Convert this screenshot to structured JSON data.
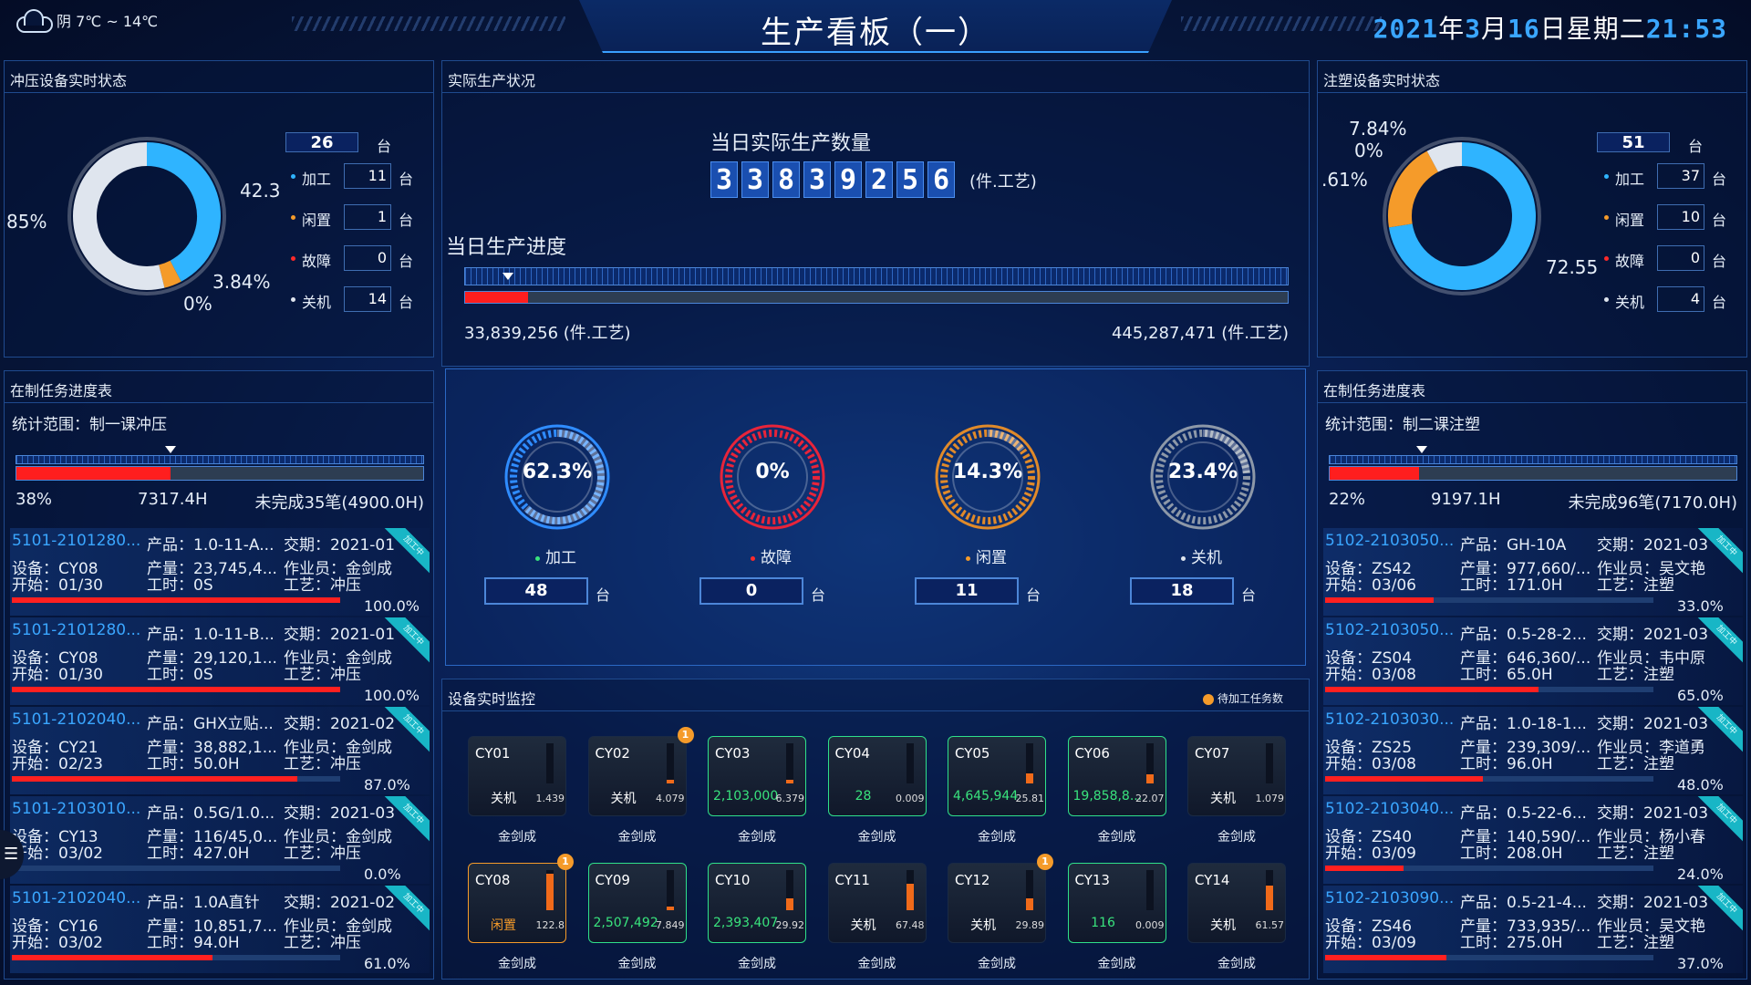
{
  "header": {
    "title": "生产看板（一）",
    "weather": "阴 7℃ ~ 14℃",
    "date_year": "2021",
    "date_month": "3",
    "date_day": "16",
    "weekday": "日星期二",
    "time": "21:53"
  },
  "left_top": {
    "title": "冲压设备实时状态",
    "total": "26",
    "unit": "台",
    "legend": [
      {
        "label": "加工",
        "value": "11",
        "color": "#2fb4ff"
      },
      {
        "label": "闲置",
        "value": "1",
        "color": "#f59b2a"
      },
      {
        "label": "故障",
        "value": "0",
        "color": "#ff2a2a"
      },
      {
        "label": "关机",
        "value": "14",
        "color": "#dfe5ee"
      }
    ],
    "pct_labels": [
      "85%",
      "42.3",
      "3.84%",
      "0%"
    ],
    "donut": [
      42.3,
      3.84,
      0,
      53.86
    ]
  },
  "center_top": {
    "title": "实际生产状况",
    "qty_label": "当日实际生产数量",
    "digits": [
      "3",
      "3",
      "8",
      "3",
      "9",
      "2",
      "5",
      "6"
    ],
    "qty_unit": "(件.工艺)",
    "progress_label": "当日生产进度",
    "progress_fraction": 0.076,
    "left_value": "33,839,256 (件.工艺)",
    "right_value": "445,287,471 (件.工艺)"
  },
  "right_top": {
    "title": "注塑设备实时状态",
    "total": "51",
    "unit": "台",
    "legend": [
      {
        "label": "加工",
        "value": "37",
        "color": "#2fb4ff"
      },
      {
        "label": "闲置",
        "value": "10",
        "color": "#f59b2a"
      },
      {
        "label": "故障",
        "value": "0",
        "color": "#ff2a2a"
      },
      {
        "label": "关机",
        "value": "4",
        "color": "#dfe5ee"
      }
    ],
    "pct_labels": [
      "7.84%",
      "0%",
      ".61%",
      "72.55"
    ],
    "donut": [
      72.55,
      19.61,
      0,
      7.84
    ]
  },
  "gauges": [
    {
      "pct": "62.3%",
      "value": 62.3,
      "label": "加工",
      "count": "48",
      "unit": "台",
      "color": "#2f8cff",
      "dot": "#39e37d"
    },
    {
      "pct": "0%",
      "value": 0,
      "label": "故障",
      "count": "0",
      "unit": "台",
      "color": "#e8243a",
      "dot": "#ff2a2a"
    },
    {
      "pct": "14.3%",
      "value": 14.3,
      "label": "闲置",
      "count": "11",
      "unit": "台",
      "color": "#e08a2a",
      "dot": "#f59b2a"
    },
    {
      "pct": "23.4%",
      "value": 23.4,
      "label": "关机",
      "count": "18",
      "unit": "台",
      "color": "#8d98a8",
      "dot": "#dfe5ee"
    }
  ],
  "left_tasks": {
    "title": "在制任务进度表",
    "range": "统计范围：制一课冲压",
    "progress_fraction": 0.38,
    "stat_pct": "38%",
    "stat_hours": "7317.4H",
    "stat_remaining": "未完成35笔(4900.0H)",
    "ribbon": "加工中",
    "items": [
      {
        "id": "5101-2101280...",
        "product": "产品：1.0-11-A...",
        "due": "交期：2021-01",
        "device": "设备：CY08",
        "qty": "产量：23,745,4...",
        "worker": "作业员：金剑成",
        "start": "开始：01/30",
        "hours": "工时：0S",
        "process": "工艺：冲压",
        "pct": "100.0%",
        "progress": 1.0
      },
      {
        "id": "5101-2101280...",
        "product": "产品：1.0-11-B...",
        "due": "交期：2021-01",
        "device": "设备：CY08",
        "qty": "产量：29,120,1...",
        "worker": "作业员：金剑成",
        "start": "开始：01/30",
        "hours": "工时：0S",
        "process": "工艺：冲压",
        "pct": "100.0%",
        "progress": 1.0
      },
      {
        "id": "5101-2102040...",
        "product": "产品：GHX立贴...",
        "due": "交期：2021-02",
        "device": "设备：CY21",
        "qty": "产量：38,882,1...",
        "worker": "作业员：金剑成",
        "start": "开始：02/23",
        "hours": "工时：50.0H",
        "process": "工艺：冲压",
        "pct": "87.0%",
        "progress": 0.87
      },
      {
        "id": "5101-2103010...",
        "product": "产品：0.5G/1.0...",
        "due": "交期：2021-03",
        "device": "设备：CY13",
        "qty": "产量：116/45,0...",
        "worker": "作业员：金剑成",
        "start": "开始：03/02",
        "hours": "工时：427.0H",
        "process": "工艺：冲压",
        "pct": "0.0%",
        "progress": 0.0
      },
      {
        "id": "5101-2102040...",
        "product": "产品：1.0A直针",
        "due": "交期：2021-02",
        "device": "设备：CY16",
        "qty": "产量：10,851,7...",
        "worker": "作业员：金剑成",
        "start": "开始：03/02",
        "hours": "工时：94.0H",
        "process": "工艺：冲压",
        "pct": "61.0%",
        "progress": 0.61
      }
    ]
  },
  "right_tasks": {
    "title": "在制任务进度表",
    "range": "统计范围：制二课注塑",
    "progress_fraction": 0.22,
    "stat_pct": "22%",
    "stat_hours": "9197.1H",
    "stat_remaining": "未完成96笔(7170.0H)",
    "ribbon": "加工中",
    "items": [
      {
        "id": "5102-2103050...",
        "product": "产品：GH-10A",
        "due": "交期：2021-03",
        "device": "设备：ZS42",
        "qty": "产量：977,660/...",
        "worker": "作业员：吴文艳",
        "start": "开始：03/06",
        "hours": "工时：171.0H",
        "process": "工艺：注塑",
        "pct": "33.0%",
        "progress": 0.33
      },
      {
        "id": "5102-2103050...",
        "product": "产品：0.5-28-2...",
        "due": "交期：2021-03",
        "device": "设备：ZS04",
        "qty": "产量：646,360/...",
        "worker": "作业员：韦中原",
        "start": "开始：03/08",
        "hours": "工时：65.0H",
        "process": "工艺：注塑",
        "pct": "65.0%",
        "progress": 0.65
      },
      {
        "id": "5102-2103030...",
        "product": "产品：1.0-18-1...",
        "due": "交期：2021-03",
        "device": "设备：ZS25",
        "qty": "产量：239,309/...",
        "worker": "作业员：李道勇",
        "start": "开始：03/08",
        "hours": "工时：96.0H",
        "process": "工艺：注塑",
        "pct": "48.0%",
        "progress": 0.48
      },
      {
        "id": "5102-2103040...",
        "product": "产品：0.5-22-6...",
        "due": "交期：2021-03",
        "device": "设备：ZS40",
        "qty": "产量：140,590/...",
        "worker": "作业员：杨小春",
        "start": "开始：03/09",
        "hours": "工时：208.0H",
        "process": "工艺：注塑",
        "pct": "24.0%",
        "progress": 0.24
      },
      {
        "id": "5102-2103090...",
        "product": "产品：0.5-21-4...",
        "due": "交期：2021-03",
        "device": "设备：ZS46",
        "qty": "产量：733,935/...",
        "worker": "作业员：吴文艳",
        "start": "开始：03/09",
        "hours": "工时：275.0H",
        "process": "工艺：注塑",
        "pct": "37.0%",
        "progress": 0.37
      }
    ]
  },
  "monitor": {
    "title": "设备实时监控",
    "legend": "待加工任务数",
    "devices": [
      {
        "code": "CY01",
        "state": "关机",
        "small": "1.439",
        "name": "金剑成",
        "level": 0.0,
        "style": "off",
        "badge": ""
      },
      {
        "code": "CY02",
        "state": "关机",
        "small": "4.079",
        "name": "金剑成",
        "level": 0.1,
        "style": "off",
        "badge": "1"
      },
      {
        "code": "CY03",
        "state": "2,103,000",
        "small": "6.379",
        "name": "金剑成",
        "level": 0.08,
        "style": "green",
        "badge": ""
      },
      {
        "code": "CY04",
        "state": "28",
        "small": "0.009",
        "name": "金剑成",
        "level": 0.0,
        "style": "green",
        "badge": ""
      },
      {
        "code": "CY05",
        "state": "4,645,944",
        "small": "25.81",
        "name": "金剑成",
        "level": 0.25,
        "style": "green",
        "badge": ""
      },
      {
        "code": "CY06",
        "state": "19,858,8...",
        "small": "22.07",
        "name": "金剑成",
        "level": 0.22,
        "style": "green",
        "badge": ""
      },
      {
        "code": "CY07",
        "state": "关机",
        "small": "1.079",
        "name": "金剑成",
        "level": 0.0,
        "style": "off",
        "badge": ""
      },
      {
        "code": "CY08",
        "state": "闲置",
        "small": "122.8",
        "name": "金剑成",
        "level": 0.9,
        "style": "idle",
        "badge": "1"
      },
      {
        "code": "CY09",
        "state": "2,507,492",
        "small": "7.849",
        "name": "金剑成",
        "level": 0.08,
        "style": "green",
        "badge": ""
      },
      {
        "code": "CY10",
        "state": "2,393,407",
        "small": "29.92",
        "name": "金剑成",
        "level": 0.3,
        "style": "green",
        "badge": ""
      },
      {
        "code": "CY11",
        "state": "关机",
        "small": "67.48",
        "name": "金剑成",
        "level": 0.67,
        "style": "off",
        "badge": ""
      },
      {
        "code": "CY12",
        "state": "关机",
        "small": "29.89",
        "name": "金剑成",
        "level": 0.3,
        "style": "off",
        "badge": "1"
      },
      {
        "code": "CY13",
        "state": "116",
        "small": "0.009",
        "name": "金剑成",
        "level": 0.0,
        "style": "green",
        "badge": ""
      },
      {
        "code": "CY14",
        "state": "关机",
        "small": "61.57",
        "name": "金剑成",
        "level": 0.62,
        "style": "off",
        "badge": ""
      }
    ]
  },
  "side_button_icon": "list-icon"
}
